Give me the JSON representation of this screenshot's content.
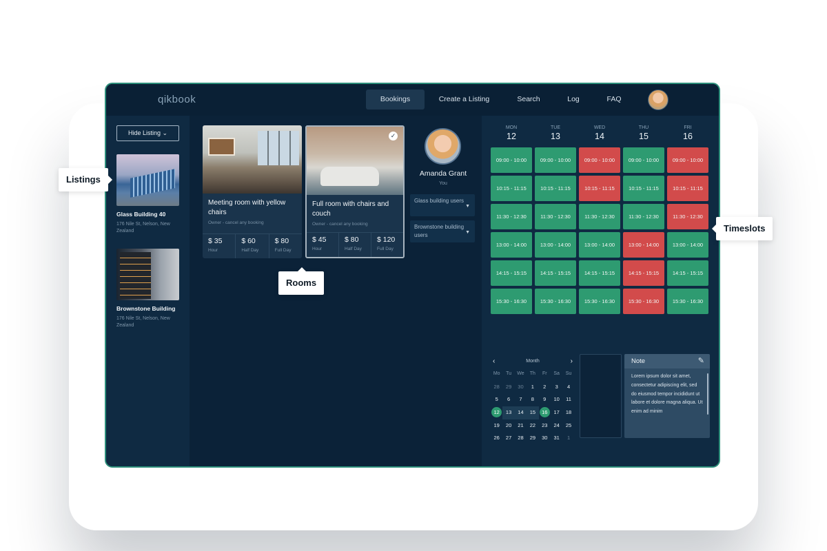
{
  "app": {
    "logo": "qikbook"
  },
  "nav": [
    {
      "label": "Bookings",
      "active": true
    },
    {
      "label": "Create a Listing"
    },
    {
      "label": "Search"
    },
    {
      "label": "Log"
    },
    {
      "label": "FAQ"
    }
  ],
  "sidebar": {
    "hide_button": "Hide Listing",
    "hide_icon": "chevron-down-icon",
    "listings": [
      {
        "name": "Glass Building 40",
        "address": "176 Nile St, Nelson, New Zealand"
      },
      {
        "name": "Brownstone Building",
        "address": "176 Nile St, Nelson, New Zealand"
      }
    ]
  },
  "rooms": [
    {
      "title": "Meeting room with yellow chairs",
      "owner": "Owner - cancel any booking",
      "prices": [
        {
          "value": "$ 35",
          "label": "Hour"
        },
        {
          "value": "$ 60",
          "label": "Half Day"
        },
        {
          "value": "$ 80",
          "label": "Full Day"
        }
      ]
    },
    {
      "title": "Full room with chairs and couch",
      "owner": "Owner - cancel any booking",
      "selected": true,
      "prices": [
        {
          "value": "$ 45",
          "label": "Hour"
        },
        {
          "value": "$ 80",
          "label": "Half Day"
        },
        {
          "value": "$ 120",
          "label": "Full Day"
        }
      ]
    }
  ],
  "user": {
    "name": "Amanda Grant",
    "subtitle": "You",
    "dropdowns": [
      "Glass building users",
      "Brownstone building users"
    ]
  },
  "schedule": {
    "days": [
      {
        "name": "MON",
        "date": "12"
      },
      {
        "name": "TUE",
        "date": "13"
      },
      {
        "name": "WED",
        "date": "14"
      },
      {
        "name": "THU",
        "date": "15"
      },
      {
        "name": "FRI",
        "date": "16"
      }
    ],
    "times": [
      "09:00 - 10:00",
      "10:15 - 11:15",
      "11:30 - 12:30",
      "13:00 - 14:00",
      "14:15 - 15:15",
      "15:30 - 16:30"
    ],
    "status": [
      [
        "free",
        "free",
        "busy",
        "free",
        "busy"
      ],
      [
        "free",
        "free",
        "busy",
        "free",
        "busy"
      ],
      [
        "free",
        "free",
        "free",
        "free",
        "busy"
      ],
      [
        "free",
        "free",
        "free",
        "busy",
        "free"
      ],
      [
        "free",
        "free",
        "free",
        "busy",
        "free"
      ],
      [
        "free",
        "free",
        "free",
        "busy",
        "free"
      ]
    ],
    "colors": {
      "free": "#2e9b71",
      "busy": "#d24b4b"
    }
  },
  "calendar": {
    "label": "Month",
    "weekdays": [
      "Mo",
      "Tu",
      "We",
      "Th",
      "Fr",
      "Sa",
      "Su"
    ],
    "weeks": [
      [
        "28",
        "29",
        "30",
        "1",
        "2",
        "3",
        "4"
      ],
      [
        "5",
        "6",
        "7",
        "8",
        "9",
        "10",
        "11"
      ],
      [
        "12",
        "13",
        "14",
        "15",
        "16",
        "17",
        "18"
      ],
      [
        "19",
        "20",
        "21",
        "22",
        "23",
        "24",
        "25"
      ],
      [
        "26",
        "27",
        "28",
        "29",
        "30",
        "31",
        "1"
      ]
    ]
  },
  "note": {
    "title": "Note",
    "body": "Lorem ipsum dolor sit amet, consectetur adipiscing elit, sed do eiusmod tempor incididunt ut labore et dolore magna aliqua. Ut enim ad minim"
  },
  "callouts": {
    "listings": "Listings",
    "rooms": "Rooms",
    "timeslots": "Timeslots"
  }
}
